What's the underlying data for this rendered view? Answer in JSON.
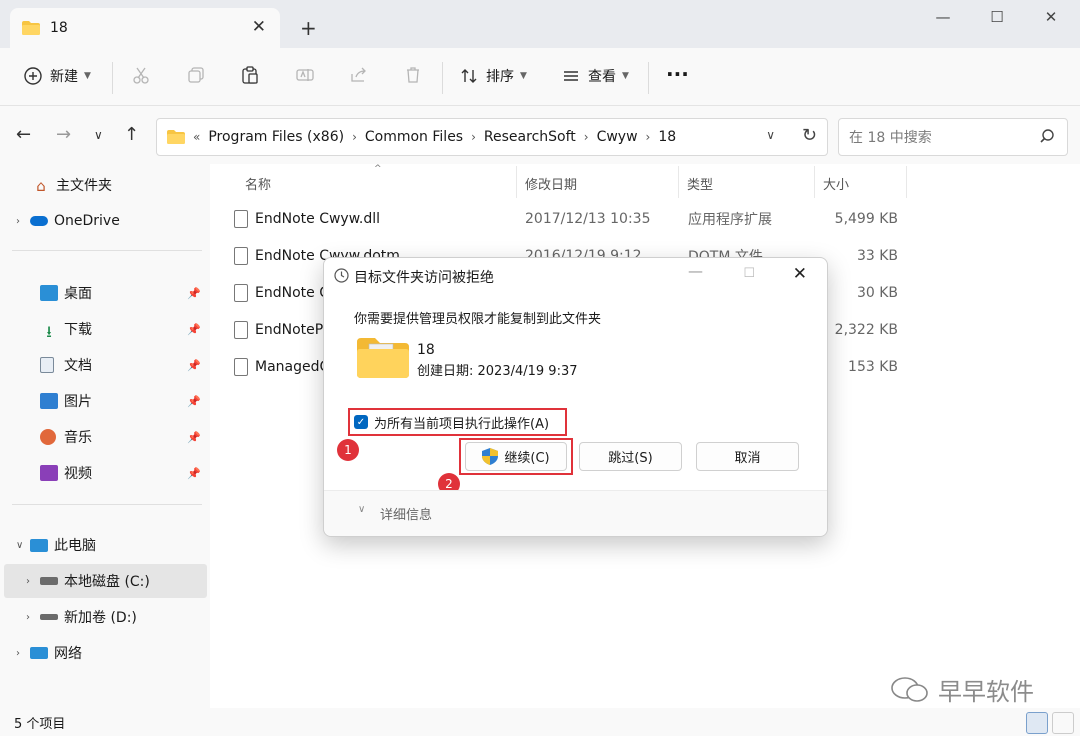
{
  "titlebar": {
    "tab_label": "18",
    "new_tab": "+",
    "minimize": "—",
    "maximize": "☐",
    "close": "✕"
  },
  "commandbar": {
    "new_label": "新建",
    "sort_label": "排序",
    "view_label": "查看",
    "more": "···"
  },
  "address": {
    "overflow": "«",
    "crumbs": [
      "Program Files (x86)",
      "Common Files",
      "ResearchSoft",
      "Cwyw",
      "18"
    ],
    "search_placeholder": "在 18 中搜索"
  },
  "sidebar": {
    "items": [
      {
        "label": "主文件夹"
      },
      {
        "label": "OneDrive"
      },
      {
        "label": "桌面"
      },
      {
        "label": "下载"
      },
      {
        "label": "文档"
      },
      {
        "label": "图片"
      },
      {
        "label": "音乐"
      },
      {
        "label": "视频"
      },
      {
        "label": "此电脑"
      },
      {
        "label": "本地磁盘 (C:)"
      },
      {
        "label": "新加卷 (D:)"
      },
      {
        "label": "网络"
      }
    ]
  },
  "columns": {
    "name": "名称",
    "modified": "修改日期",
    "type": "类型",
    "size": "大小"
  },
  "files": [
    {
      "name": "EndNote Cwyw.dll",
      "modified": "2017/12/13 10:35",
      "type": "应用程序扩展",
      "size": "5,499 KB"
    },
    {
      "name": "EndNote Cwyw.dotm",
      "modified": "2016/12/19 9:12",
      "type": "DOTM 文件",
      "size": "33 KB"
    },
    {
      "name": "EndNote C",
      "modified": "",
      "type": "",
      "size": "30 KB"
    },
    {
      "name": "EndNotePc",
      "modified": "",
      "type": "",
      "size": "2,322 KB"
    },
    {
      "name": "ManagedC",
      "modified": "",
      "type": "",
      "size": "153 KB"
    }
  ],
  "status": {
    "count": "5 个项目"
  },
  "dialog": {
    "title": "目标文件夹访问被拒绝",
    "message": "你需要提供管理员权限才能复制到此文件夹",
    "folder_name": "18",
    "created": "创建日期: 2023/4/19 9:37",
    "checkbox_label": "为所有当前项目执行此操作(A)",
    "continue_label": "继续(C)",
    "skip_label": "跳过(S)",
    "cancel_label": "取消",
    "details_label": "详细信息",
    "badge1": "1",
    "badge2": "2"
  },
  "watermark": {
    "text": "早早软件"
  },
  "colors": {
    "accent": "#0067c0",
    "annotation_red": "#e0323a",
    "folder_yellow": "#f7c543"
  }
}
